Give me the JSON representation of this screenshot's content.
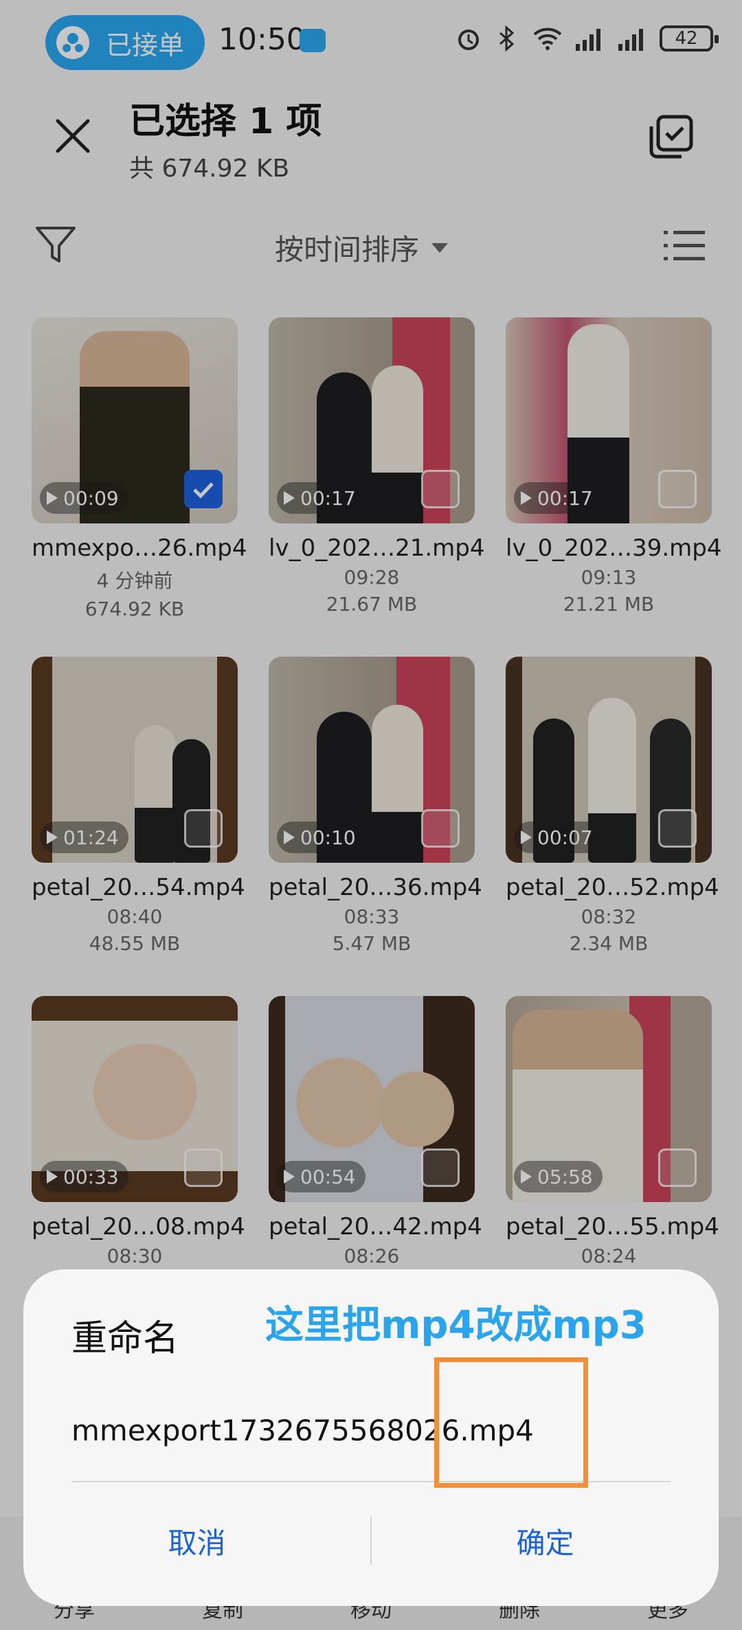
{
  "status_bar": {
    "order_pill": "已接单",
    "time": "10:50",
    "battery": "42"
  },
  "header": {
    "title": "已选择 1 项",
    "subtitle": "共 674.92 KB"
  },
  "toolbar": {
    "sort_label": "按时间排序"
  },
  "files": [
    {
      "name": "mmexpo…26.mp4",
      "time": "4 分钟前",
      "size": "674.92 KB",
      "duration": "00:09",
      "checked": true
    },
    {
      "name": "lv_0_202…21.mp4",
      "time": "09:28",
      "size": "21.67 MB",
      "duration": "00:17",
      "checked": false
    },
    {
      "name": "lv_0_202…39.mp4",
      "time": "09:13",
      "size": "21.21 MB",
      "duration": "00:17",
      "checked": false
    },
    {
      "name": "petal_20…54.mp4",
      "time": "08:40",
      "size": "48.55 MB",
      "duration": "01:24",
      "checked": false
    },
    {
      "name": "petal_20…36.mp4",
      "time": "08:33",
      "size": "5.47 MB",
      "duration": "00:10",
      "checked": false
    },
    {
      "name": "petal_20…52.mp4",
      "time": "08:32",
      "size": "2.34 MB",
      "duration": "00:07",
      "checked": false
    },
    {
      "name": "petal_20…08.mp4",
      "time": "08:30",
      "size": "",
      "duration": "00:33",
      "checked": false
    },
    {
      "name": "petal_20…42.mp4",
      "time": "08:26",
      "size": "",
      "duration": "00:54",
      "checked": false
    },
    {
      "name": "petal_20…55.mp4",
      "time": "08:24",
      "size": "",
      "duration": "05:58",
      "checked": false
    }
  ],
  "bottom_bar": [
    "分享",
    "复制",
    "移动",
    "删除",
    "更多"
  ],
  "dialog": {
    "title": "重命名",
    "annotation": "这里把mp4改成mp3",
    "input_value": "mmexport1732675568026.mp4",
    "cancel_label": "取消",
    "confirm_label": "确定"
  },
  "colors": {
    "accent": "#1e63d6",
    "annotation": "#2aa4ec",
    "highlight": "#f19036",
    "pill": "#2aa8f0"
  }
}
